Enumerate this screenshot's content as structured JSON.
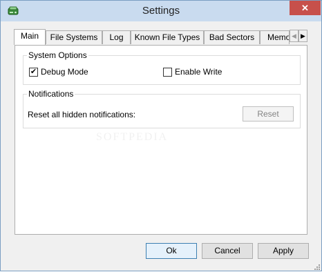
{
  "window": {
    "title": "Settings",
    "app_icon": "disk-drive-green-icon",
    "close_glyph": "✕"
  },
  "tabs": [
    {
      "label": "Main",
      "active": true
    },
    {
      "label": "File Systems",
      "active": false
    },
    {
      "label": "Log",
      "active": false
    },
    {
      "label": "Known File Types",
      "active": false
    },
    {
      "label": "Bad Sectors",
      "active": false
    },
    {
      "label": "Memo",
      "active": false
    }
  ],
  "tab_scroll": {
    "left_glyph": "◀",
    "right_glyph": "▶"
  },
  "system_options": {
    "title": "System Options",
    "debug_mode": {
      "label": "Debug Mode",
      "checked": true,
      "check_glyph": "✔"
    },
    "enable_write": {
      "label": "Enable Write",
      "checked": false
    }
  },
  "notifications": {
    "title": "Notifications",
    "reset_label": "Reset all hidden notifications:",
    "reset_button": "Reset",
    "reset_enabled": false
  },
  "watermark": "SOFTPEDIA",
  "buttons": {
    "ok": "Ok",
    "cancel": "Cancel",
    "apply": "Apply"
  },
  "colors": {
    "titlebar": "#c9dbef",
    "close": "#c7504b",
    "default_button_border": "#3c7fb1"
  }
}
